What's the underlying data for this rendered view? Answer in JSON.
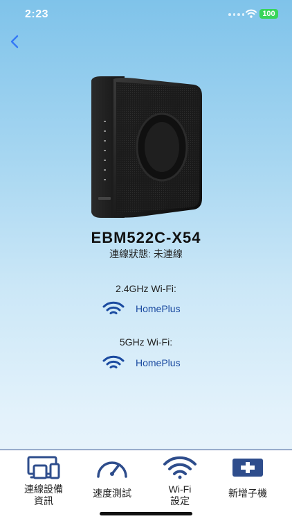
{
  "status_bar": {
    "time": "2:23",
    "battery": "100"
  },
  "device": {
    "model": "EBM522C-X54",
    "status": "連線狀態: 未連線"
  },
  "wifi_bands": [
    {
      "label": "2.4GHz Wi-Fi:",
      "ssid": "HomePlus"
    },
    {
      "label": "5GHz Wi-Fi:",
      "ssid": "HomePlus"
    }
  ],
  "bottom_nav": [
    {
      "label_line1": "連線設備",
      "label_line2": "資訊",
      "icon": "devices-icon"
    },
    {
      "label_line1": "速度測試",
      "label_line2": "",
      "icon": "speedometer-icon"
    },
    {
      "label_line1": "Wi-Fi",
      "label_line2": "設定",
      "icon": "wifi-icon"
    },
    {
      "label_line1": "新增子機",
      "label_line2": "",
      "icon": "add-icon"
    }
  ],
  "colors": {
    "accent": "#2e4d8c",
    "link": "#1a4aa0",
    "back": "#3478f6",
    "battery": "#38d55a"
  }
}
